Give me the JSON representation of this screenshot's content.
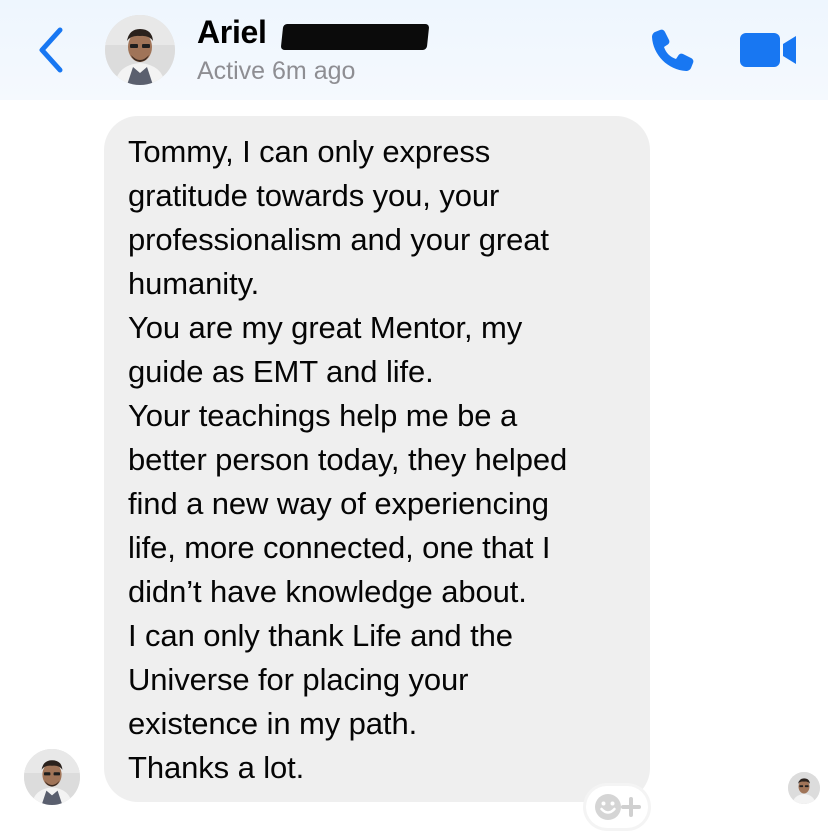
{
  "header": {
    "contact_name": "Ariel",
    "status": "Active 6m ago",
    "back_icon": "chevron-left-icon",
    "call_icon": "phone-icon",
    "video_icon": "video-camera-icon"
  },
  "message": {
    "lines": [
      "Tommy, I can only express",
      "gratitude towards you, your",
      "professionalism and your great",
      "humanity.",
      "You are my great Mentor, my",
      "guide as EMT and life.",
      "Your teachings help me be a",
      "better person today, they helped",
      "find a new way of experiencing",
      "life, more connected, one that I",
      "didn’t have knowledge about.",
      "I can only thank Life and the",
      "Universe for placing your",
      "existence in my path.",
      "Thanks a lot."
    ]
  },
  "reaction_button": {
    "icon": "add-reaction-icon"
  },
  "colors": {
    "accent": "#1877f2",
    "bubble": "#efefef",
    "status_text": "#8e8e93",
    "header_bg": "#eef6fe"
  }
}
